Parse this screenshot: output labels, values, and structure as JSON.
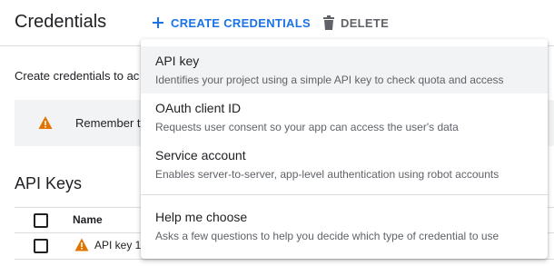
{
  "header": {
    "title": "Credentials",
    "create_label": "CREATE CREDENTIALS",
    "delete_label": "DELETE"
  },
  "main": {
    "intro": "Create credentials to ac",
    "notice": "Remember t",
    "section_title": "API Keys",
    "table": {
      "columns": [
        "Name"
      ],
      "rows": [
        {
          "name": "API key 1"
        }
      ]
    }
  },
  "menu": {
    "items": [
      {
        "title": "API key",
        "description": "Identifies your project using a simple API key to check quota and access"
      },
      {
        "title": "OAuth client ID",
        "description": "Requests user consent so your app can access the user's data"
      },
      {
        "title": "Service account",
        "description": "Enables server-to-server, app-level authentication using robot accounts"
      },
      {
        "title": "Help me choose",
        "description": "Asks a few questions to help you decide which type of credential to use"
      }
    ]
  },
  "colors": {
    "accent": "#1a73e8",
    "warning": "#e37400",
    "muted": "#5f6368",
    "hover": "#f1f3f4"
  },
  "icons": {
    "create": "plus-icon",
    "delete": "trash-icon",
    "notice": "warning-icon",
    "row": "warning-icon"
  }
}
